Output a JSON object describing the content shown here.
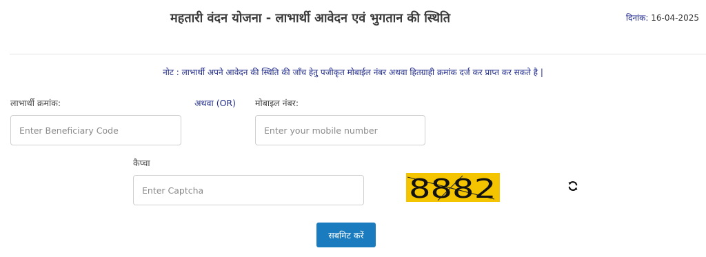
{
  "header": {
    "title": "महतारी वंदन योजना - लाभार्थी आवेदन एवं भुगतान की स्थिति",
    "date_label": "दिनांक:",
    "date_value": "16-04-2025"
  },
  "note": "नोट : लाभार्थी अपने आवेदन की स्थिति की जाँच हेतु पजीकृत मोबाईल नंबर अथवा हितग्राही क्रमांक दर्ज कर प्राप्त कर सकते है |",
  "form": {
    "beneficiary_label": "लाभार्थी क्रमांक:",
    "beneficiary_placeholder": "Enter Beneficiary Code",
    "or_label": "अथवा (OR)",
    "mobile_label": "मोबाइल नंबर:",
    "mobile_placeholder": "Enter your mobile number",
    "captcha_label": "कैप्चा",
    "captcha_placeholder": "Enter Captcha",
    "captcha_text": "8882",
    "captcha_bg": "#f5c400",
    "submit_label": "सबमिट करें",
    "submit_color": "#1a7bbf"
  }
}
